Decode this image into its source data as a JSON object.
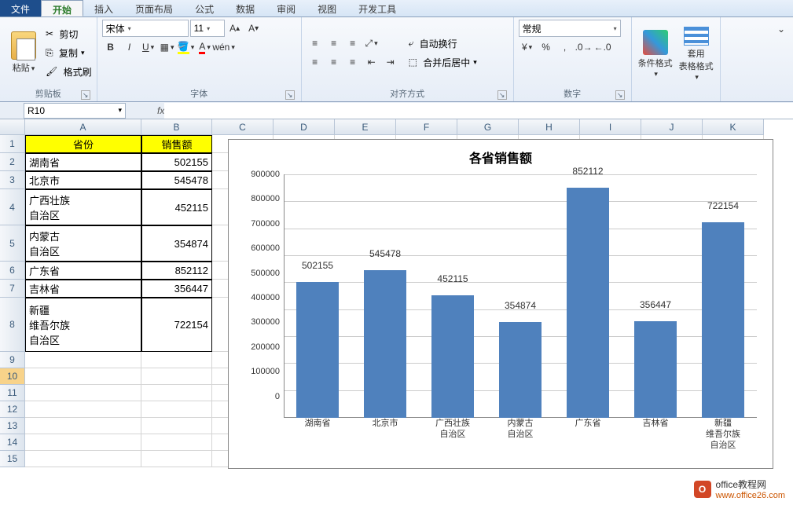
{
  "tabs": {
    "file": "文件",
    "home": "开始",
    "insert": "插入",
    "layout": "页面布局",
    "formula": "公式",
    "data": "数据",
    "review": "审阅",
    "view": "视图",
    "dev": "开发工具"
  },
  "ribbon": {
    "clipboard": {
      "paste": "粘贴",
      "cut": "剪切",
      "copy": "复制",
      "format_painter": "格式刷",
      "label": "剪贴板"
    },
    "font": {
      "name": "宋体",
      "size": "11",
      "label": "字体"
    },
    "align": {
      "wrap": "自动换行",
      "merge": "合并后居中",
      "label": "对齐方式"
    },
    "number": {
      "format": "常规",
      "label": "数字"
    },
    "styles": {
      "cond_format": "条件格式",
      "table_format": "套用\n表格格式"
    }
  },
  "namebox": "R10",
  "spreadsheet": {
    "columns": [
      "A",
      "B",
      "C",
      "D",
      "E",
      "F",
      "G",
      "H",
      "I",
      "J",
      "K"
    ],
    "headers": {
      "province": "省份",
      "sales": "销售额"
    },
    "rows": [
      {
        "province": "湖南省",
        "sales": "502155"
      },
      {
        "province": "北京市",
        "sales": "545478"
      },
      {
        "province": "广西壮族\n自治区",
        "sales": "452115"
      },
      {
        "province": "内蒙古\n自治区",
        "sales": "354874"
      },
      {
        "province": "广东省",
        "sales": "852112"
      },
      {
        "province": "吉林省",
        "sales": "356447"
      },
      {
        "province": "新疆\n维吾尔族\n自治区",
        "sales": "722154"
      }
    ]
  },
  "chart_data": {
    "type": "bar",
    "title": "各省销售额",
    "categories": [
      "湖南省",
      "北京市",
      "广西壮族\n自治区",
      "内蒙古\n自治区",
      "广东省",
      "吉林省",
      "新疆\n维吾尔族\n自治区"
    ],
    "values": [
      502155,
      545478,
      452115,
      354874,
      852112,
      356447,
      722154
    ],
    "ylim": [
      0,
      900000
    ],
    "y_ticks": [
      0,
      100000,
      200000,
      300000,
      400000,
      500000,
      600000,
      700000,
      800000,
      900000
    ],
    "xlabel": "",
    "ylabel": ""
  },
  "watermark": {
    "name": "office教程网",
    "url": "www.office26.com"
  }
}
